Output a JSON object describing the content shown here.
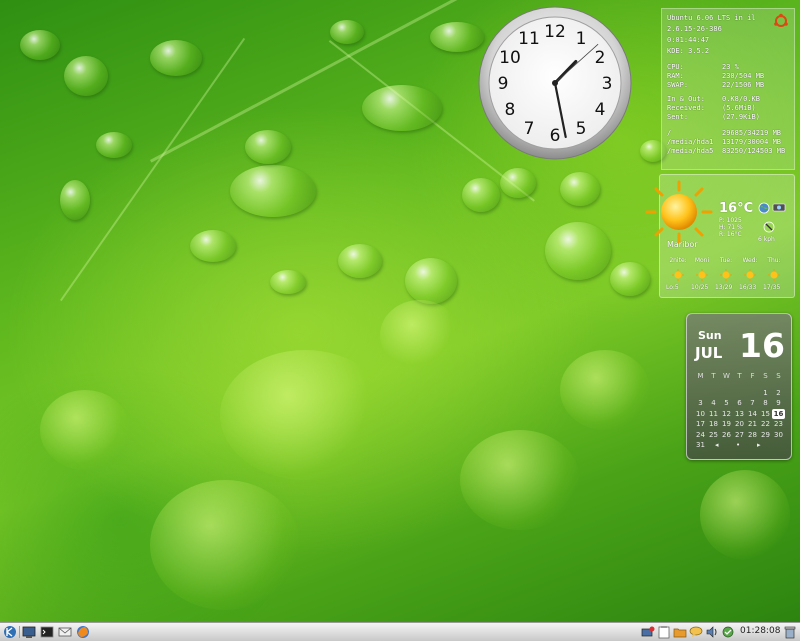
{
  "sysmon": {
    "header": [
      "Ubuntu 6.06 LTS in il",
      "2.6.15-26-386",
      "0:01:44:47",
      "KDE: 3.5.2"
    ],
    "resources": [
      {
        "label": "CPU:",
        "value": "23 %"
      },
      {
        "label": "RAM:",
        "value": "230/504 MB"
      },
      {
        "label": "SWAP:",
        "value": "22/1506 MB"
      }
    ],
    "network": [
      {
        "label": "In & Out:",
        "value": "0.K8/0.KB"
      },
      {
        "label": "Received:",
        "value": "(5.6MiB)"
      },
      {
        "label": "Sent:",
        "value": "(27.9KiB)"
      }
    ],
    "disks": [
      {
        "label": "/",
        "value": "29685/34219 MB"
      },
      {
        "label": "/media/hda1",
        "value": "13179/30004 MB"
      },
      {
        "label": "/media/hda5",
        "value": "83250/124503 MB"
      }
    ],
    "logo_icon": "ubuntu-logo-icon"
  },
  "weather": {
    "temperature": "16°C",
    "pressure": "P: 1025",
    "humidity": "H: 71 %",
    "realfeel": "R: 16°C",
    "wind": "6 kph",
    "city": "Maribor",
    "forecast": [
      {
        "day": "2nite:",
        "temp": "Lo:5"
      },
      {
        "day": "Moni",
        "temp": "10/25"
      },
      {
        "day": "Tue:",
        "temp": "13/29"
      },
      {
        "day": "Wed:",
        "temp": "16/33"
      },
      {
        "day": "Thu:",
        "temp": "17/35"
      }
    ],
    "icon": "sun-icon"
  },
  "calendar": {
    "weekday": "Sun",
    "month": "JUL",
    "day": "16",
    "headers": [
      "M",
      "T",
      "W",
      "T",
      "F",
      "S",
      "S"
    ],
    "weeks": [
      [
        "",
        "",
        "",
        "",
        "",
        "1",
        "2"
      ],
      [
        "3",
        "4",
        "5",
        "6",
        "7",
        "8",
        "9"
      ],
      [
        "10",
        "11",
        "12",
        "13",
        "14",
        "15",
        "16"
      ],
      [
        "17",
        "18",
        "19",
        "20",
        "21",
        "22",
        "23"
      ],
      [
        "24",
        "25",
        "26",
        "27",
        "28",
        "29",
        "30"
      ],
      [
        "31",
        "",
        "",
        "",
        "",
        "",
        ""
      ]
    ],
    "today": "16",
    "nav": [
      "◂",
      "•",
      "▸"
    ]
  },
  "clock": {
    "numbers": [
      "12",
      "1",
      "2",
      "3",
      "4",
      "5",
      "6",
      "7",
      "8",
      "9",
      "10",
      "11"
    ],
    "hour": 1,
    "minute": 28,
    "second": 8
  },
  "taskbar": {
    "time": "01:28:08",
    "launchers": [
      "kde-menu-icon",
      "desktop-icon",
      "terminal-icon",
      "mail-icon",
      "firefox-icon"
    ],
    "tray": [
      "network-icon",
      "clipboard-icon",
      "folder-icon",
      "chat-icon",
      "volume-icon",
      "update-icon"
    ],
    "trash_icon": "trash-icon"
  }
}
